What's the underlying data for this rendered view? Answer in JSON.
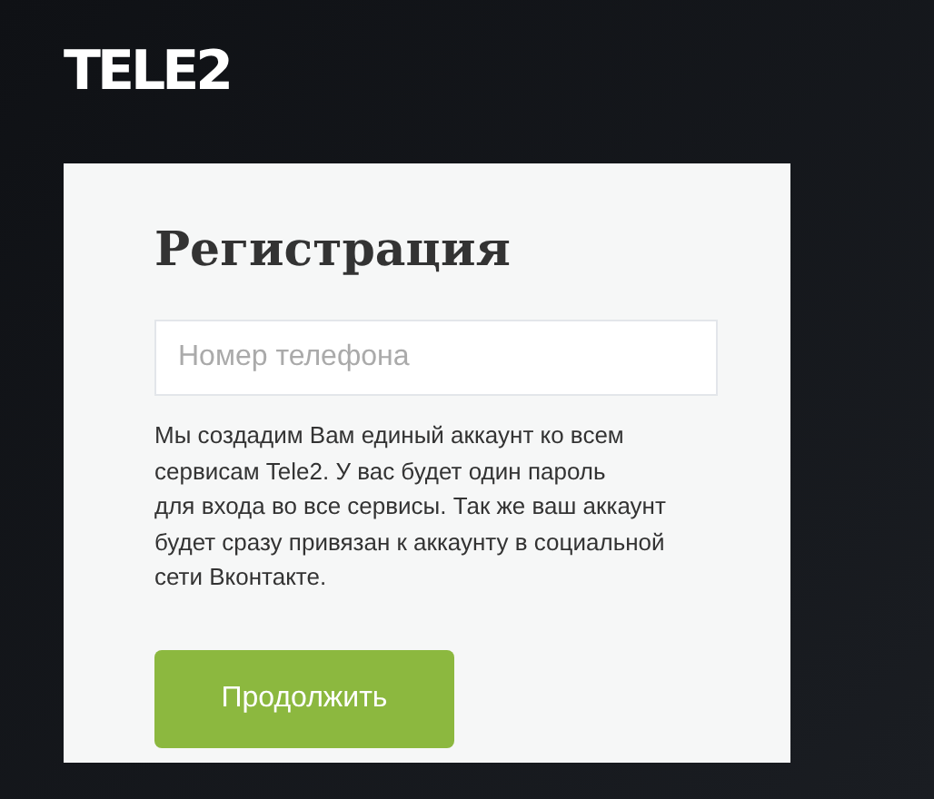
{
  "logo": "TELE2",
  "form": {
    "title": "Регистрация",
    "phone_field": {
      "placeholder": "Номер телефона"
    },
    "description": "Мы создадим Вам единый аккаунт ко всем\nсервисам Tele2. У вас будет один пароль\nдля входа во все сервисы. Так же ваш аккаунт\nбудет сразу привязан к аккаунту в социальной\nсети Вконтакте.",
    "submit": "Продолжить"
  }
}
